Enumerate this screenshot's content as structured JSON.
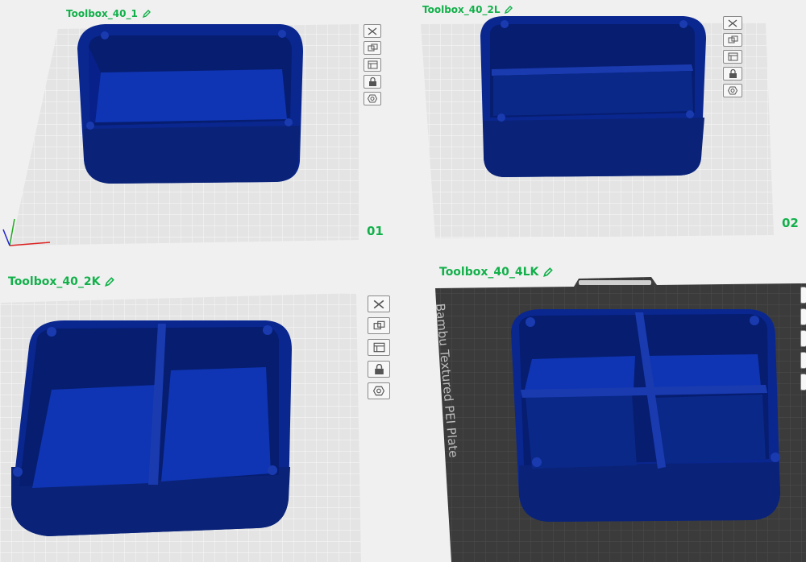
{
  "plates": [
    {
      "name": "Toolbox_40_1",
      "number": "01"
    },
    {
      "name": "Toolbox_40_2L",
      "number": "02"
    },
    {
      "name": "Toolbox_40_2K",
      "number": ""
    },
    {
      "name": "Toolbox_40_4LK",
      "number": ""
    }
  ],
  "textured_plate_label": "Bambu Textured PEI Plate",
  "toolbar_icons": [
    "close-icon",
    "arrange-icon",
    "layout-icon",
    "lock-icon",
    "settings-icon"
  ],
  "colors": {
    "label_green": "#12b04a",
    "model_blue": "#0a2a8e",
    "plate_grid": "#dcdcdc",
    "textured_plate": "#3a3a3a"
  }
}
